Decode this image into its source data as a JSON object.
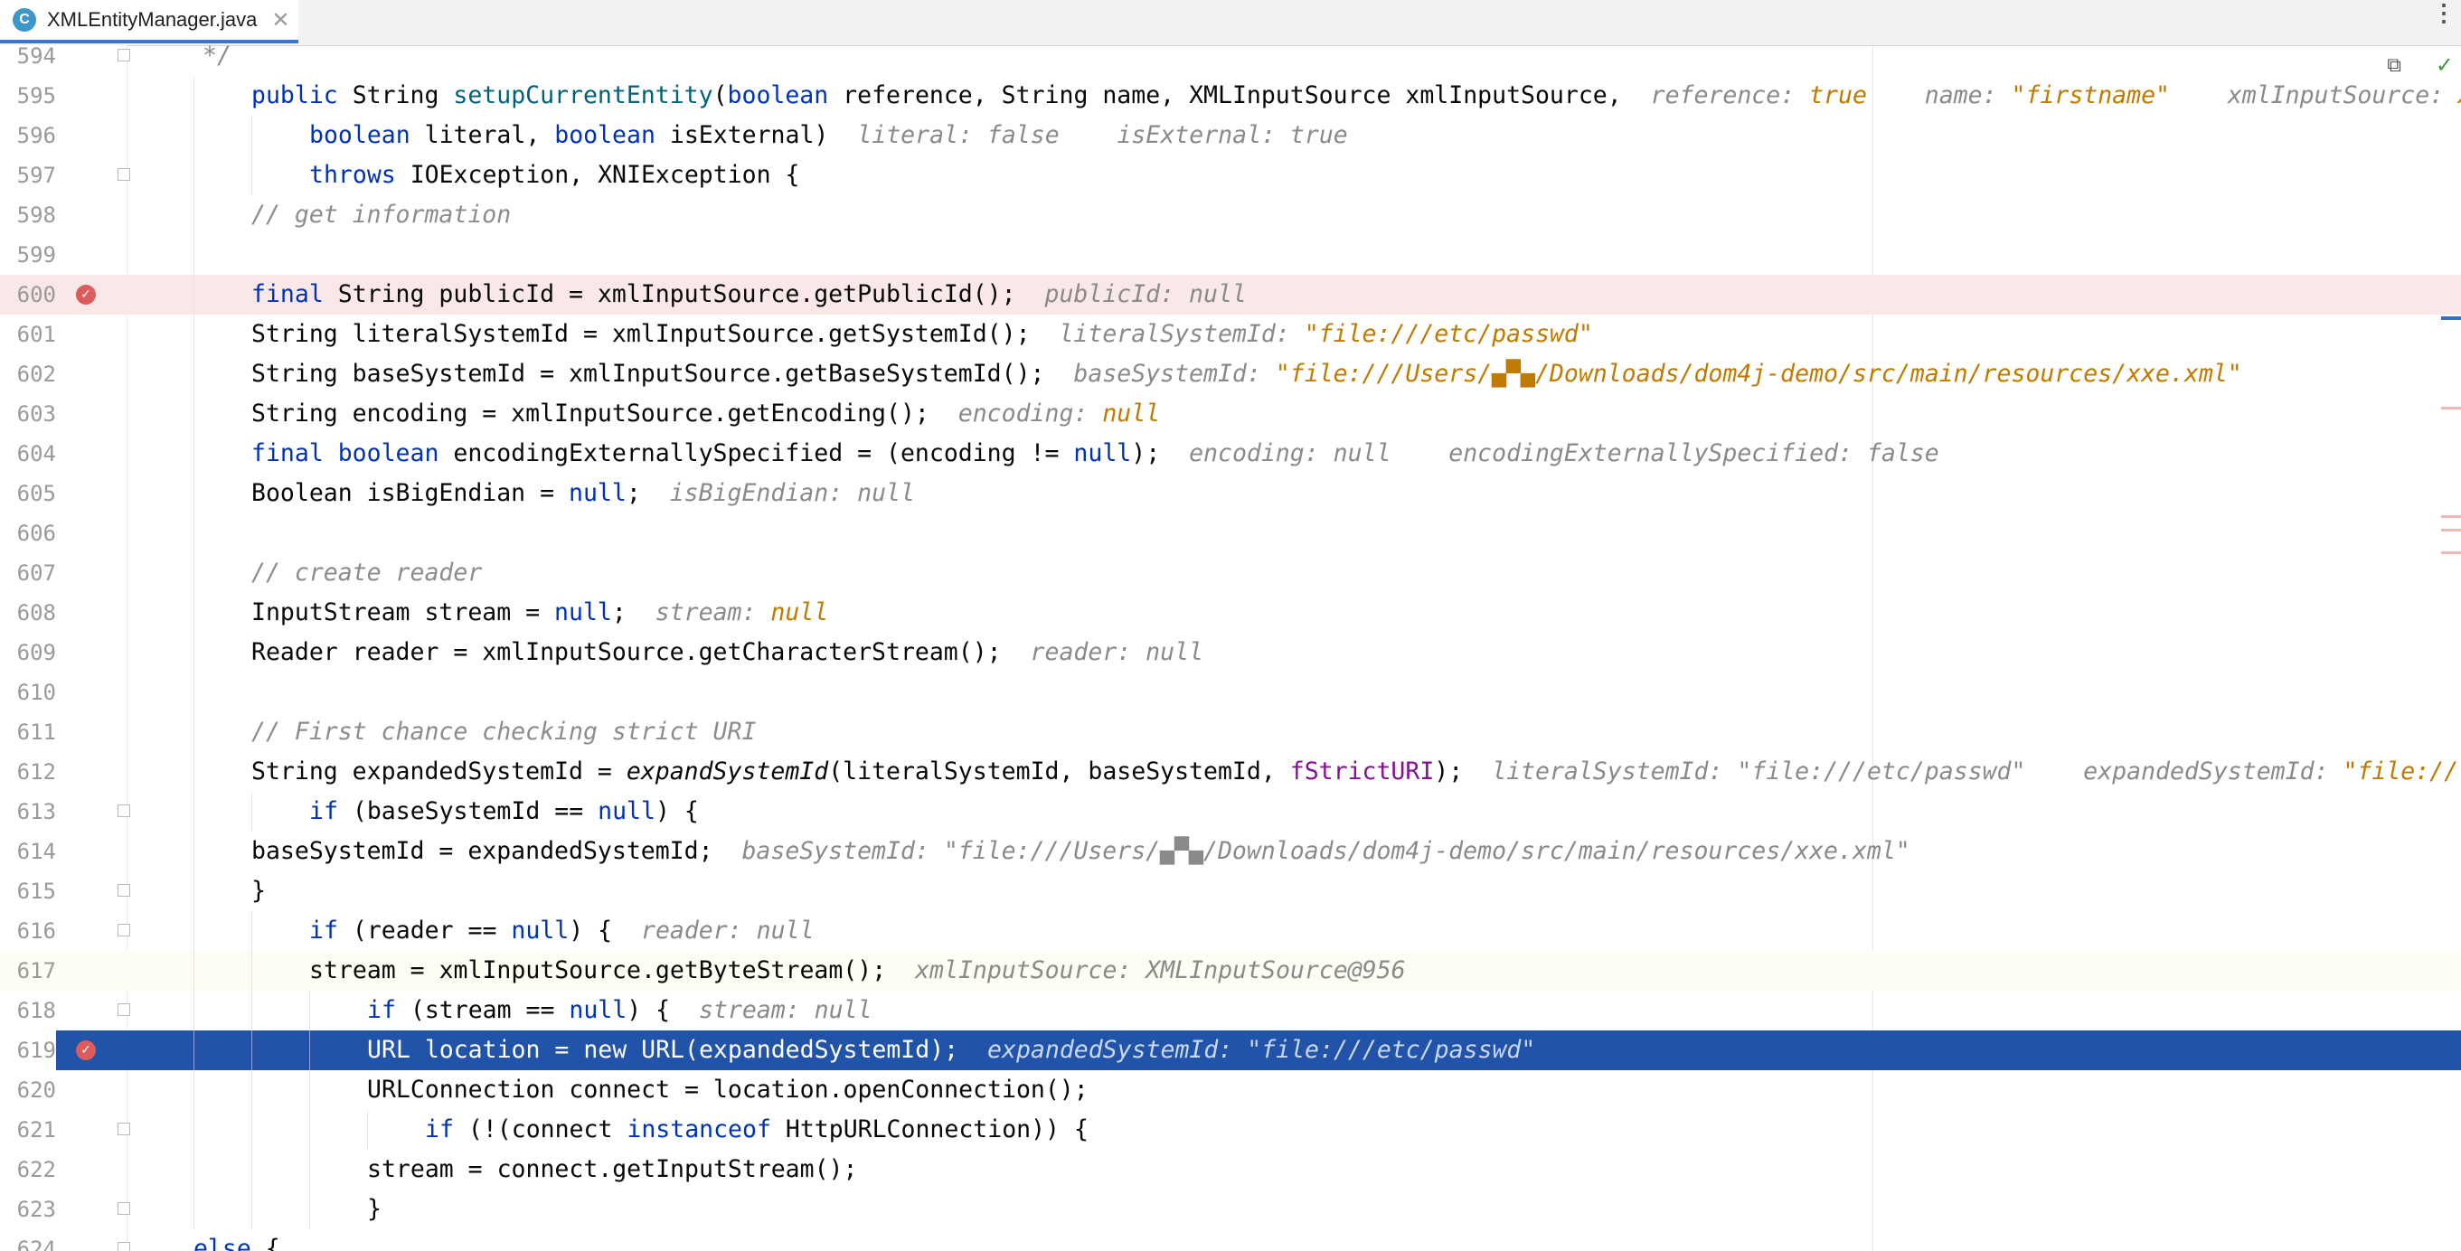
{
  "tab": {
    "icon_letter": "C",
    "file_name": "XMLEntityManager.java",
    "close_glyph": "✕",
    "menu_glyph": "⋮"
  },
  "inspector": {
    "reader_mode_glyph": "⧉",
    "status_glyph": "✓"
  },
  "lines": [
    {
      "num": "594",
      "tokens": [
        {
          "t": "*/",
          "c": "cm"
        }
      ]
    },
    {
      "num": "595",
      "tokens": [
        {
          "t": "public ",
          "c": "kw"
        },
        {
          "t": "String "
        },
        {
          "t": "setupCurrentEntity",
          "c": "fn"
        },
        {
          "t": "("
        },
        {
          "t": "boolean ",
          "c": "kw"
        },
        {
          "t": "reference, String name, XMLInputSource xmlInputSource,  "
        },
        {
          "t": "reference: ",
          "c": "h"
        },
        {
          "t": "true",
          "c": "hv"
        },
        {
          "t": "    name: ",
          "c": "h"
        },
        {
          "t": "\"firstname\"",
          "c": "hv"
        },
        {
          "t": "    xmlInputSource: ",
          "c": "h"
        },
        {
          "t": "XML",
          "c": "hv"
        }
      ]
    },
    {
      "num": "596",
      "tokens": [
        {
          "t": "boolean ",
          "c": "kw"
        },
        {
          "t": "literal, "
        },
        {
          "t": "boolean ",
          "c": "kw"
        },
        {
          "t": "isExternal)  "
        },
        {
          "t": "literal: false    isExternal: true",
          "c": "h"
        }
      ]
    },
    {
      "num": "597",
      "tokens": [
        {
          "t": "throws ",
          "c": "kw"
        },
        {
          "t": "IOException, XNIException {"
        }
      ]
    },
    {
      "num": "598",
      "tokens": [
        {
          "t": "// get information",
          "c": "cm"
        }
      ]
    },
    {
      "num": "599",
      "tokens": []
    },
    {
      "num": "600",
      "tokens": [
        {
          "t": "final ",
          "c": "kw"
        },
        {
          "t": "String publicId = xmlInputSource.getPublicId();  "
        },
        {
          "t": "publicId: null",
          "c": "h"
        }
      ]
    },
    {
      "num": "601",
      "tokens": [
        {
          "t": "String literalSystemId = xmlInputSource.getSystemId();  "
        },
        {
          "t": "literalSystemId: ",
          "c": "h"
        },
        {
          "t": "\"file:///etc/passwd\"",
          "c": "hv"
        }
      ]
    },
    {
      "num": "602",
      "tokens": [
        {
          "t": "String baseSystemId = xmlInputSource.getBaseSystemId();  "
        },
        {
          "t": "baseSystemId: ",
          "c": "h"
        },
        {
          "t": "\"file:///Users/▄▀▄/Downloads/dom4j-demo/src/main/resources/xxe.xml\"",
          "c": "hv"
        }
      ]
    },
    {
      "num": "603",
      "tokens": [
        {
          "t": "String encoding = xmlInputSource.getEncoding();  "
        },
        {
          "t": "encoding: ",
          "c": "h"
        },
        {
          "t": "null",
          "c": "hv"
        }
      ]
    },
    {
      "num": "604",
      "tokens": [
        {
          "t": "final boolean ",
          "c": "kw"
        },
        {
          "t": "encodingExternallySpecified = (encoding != "
        },
        {
          "t": "null",
          "c": "kw"
        },
        {
          "t": ");  "
        },
        {
          "t": "encoding: null    encodingExternallySpecified: false",
          "c": "h"
        }
      ]
    },
    {
      "num": "605",
      "tokens": [
        {
          "t": "Boolean isBigEndian = "
        },
        {
          "t": "null",
          "c": "kw"
        },
        {
          "t": ";  "
        },
        {
          "t": "isBigEndian: null",
          "c": "h"
        }
      ]
    },
    {
      "num": "606",
      "tokens": []
    },
    {
      "num": "607",
      "tokens": [
        {
          "t": "// create reader",
          "c": "cm"
        }
      ]
    },
    {
      "num": "608",
      "tokens": [
        {
          "t": "InputStream stream = "
        },
        {
          "t": "null",
          "c": "kw"
        },
        {
          "t": ";  "
        },
        {
          "t": "stream: ",
          "c": "h"
        },
        {
          "t": "null",
          "c": "hv"
        }
      ]
    },
    {
      "num": "609",
      "tokens": [
        {
          "t": "Reader reader = xmlInputSource.getCharacterStream();  "
        },
        {
          "t": "reader: null",
          "c": "h"
        }
      ]
    },
    {
      "num": "610",
      "tokens": []
    },
    {
      "num": "611",
      "tokens": [
        {
          "t": "// First chance checking strict URI",
          "c": "cm"
        }
      ]
    },
    {
      "num": "612",
      "tokens": [
        {
          "t": "String expandedSystemId = "
        },
        {
          "t": "expandSystemId",
          "c": "it"
        },
        {
          "t": "(literalSystemId, baseSystemId, "
        },
        {
          "t": "fStrictURI",
          "c": "fd"
        },
        {
          "t": ");  "
        },
        {
          "t": "literalSystemId: \"file:///etc/passwd\"    expandedSystemId: ",
          "c": "h"
        },
        {
          "t": "\"file://",
          "c": "hv"
        }
      ]
    },
    {
      "num": "613",
      "tokens": [
        {
          "t": "if ",
          "c": "kw"
        },
        {
          "t": "(baseSystemId == "
        },
        {
          "t": "null",
          "c": "kw"
        },
        {
          "t": ") {"
        }
      ]
    },
    {
      "num": "614",
      "tokens": [
        {
          "t": "baseSystemId = expandedSystemId;  "
        },
        {
          "t": "baseSystemId: \"file:///Users/▄▀▄/Downloads/dom4j-demo/src/main/resources/xxe.xml\"",
          "c": "h"
        }
      ]
    },
    {
      "num": "615",
      "tokens": [
        {
          "t": "}"
        }
      ]
    },
    {
      "num": "616",
      "tokens": [
        {
          "t": "if ",
          "c": "kw"
        },
        {
          "t": "(reader == "
        },
        {
          "t": "null",
          "c": "kw"
        },
        {
          "t": ") {  "
        },
        {
          "t": "reader: null",
          "c": "h"
        }
      ]
    },
    {
      "num": "617",
      "tokens": [
        {
          "t": "stream = xmlInputSource.getByteStream();  "
        },
        {
          "t": "xmlInputSource: XMLInputSource@956",
          "c": "h"
        }
      ]
    },
    {
      "num": "618",
      "tokens": [
        {
          "t": "if ",
          "c": "kw"
        },
        {
          "t": "(stream == "
        },
        {
          "t": "null",
          "c": "kw"
        },
        {
          "t": ") {  "
        },
        {
          "t": "stream: null",
          "c": "h"
        }
      ]
    },
    {
      "num": "619",
      "tokens": [
        {
          "t": "URL location = new URL(expandedSystemId);  "
        },
        {
          "t": "expandedSystemId: \"file:///etc/passwd\"",
          "c": "h"
        }
      ]
    },
    {
      "num": "620",
      "tokens": [
        {
          "t": "URLConnection connect = location.openConnection();"
        }
      ]
    },
    {
      "num": "621",
      "tokens": [
        {
          "t": "if ",
          "c": "kw"
        },
        {
          "t": "(!(connect "
        },
        {
          "t": "instanceof ",
          "c": "kw"
        },
        {
          "t": "HttpURLConnection)) {"
        }
      ]
    },
    {
      "num": "622",
      "tokens": [
        {
          "t": "stream = connect.getInputStream();"
        }
      ]
    },
    {
      "num": "623",
      "tokens": [
        {
          "t": "}"
        }
      ]
    },
    {
      "num": "624",
      "tokens": [
        {
          "t": "else ",
          "c": "kw"
        },
        {
          "t": "{"
        }
      ]
    }
  ],
  "breakpoint_glyph": "✓"
}
